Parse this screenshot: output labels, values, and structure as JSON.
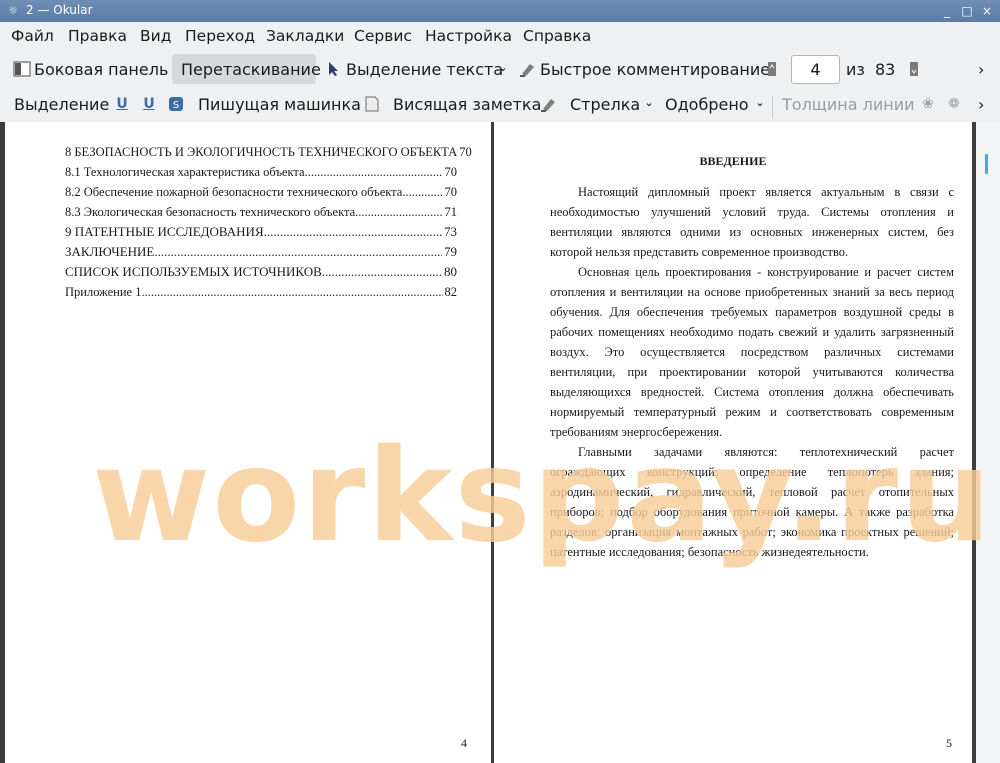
{
  "window": {
    "icon": "okular-icon",
    "title": "2  — Okular",
    "min": "_",
    "max": "□",
    "close": "×"
  },
  "menu": [
    "Файл",
    "Правка",
    "Вид",
    "Переход",
    "Закладки",
    "Сервис",
    "Настройка",
    "Справка"
  ],
  "toolbar1": {
    "sidebar": "Боковая панель",
    "drag": "Перетаскивание",
    "text_select": "Выделение текста",
    "quick_comment": "Быстрое комментирование",
    "page_current": "4",
    "page_of": "из",
    "page_total": "83",
    "more": "›"
  },
  "toolbar2": {
    "selection": "Выделение",
    "typewriter": "Пишущая машинка",
    "hanging_note": "Висящая заметка",
    "arrow": "Стрелка",
    "approved": "Одобрено",
    "line_width": "Толщина линии",
    "more": "›"
  },
  "left_page": {
    "toc": [
      {
        "label": "8 БЕЗОПАСНОСТЬ И ЭКОЛОГИЧНОСТЬ ТЕХНИЧЕСКОГО ОБЪЕКТА",
        "page": "70",
        "big": true
      },
      {
        "label": "8.1 Технологическая характеристика объекта",
        "page": "70",
        "big": false
      },
      {
        "label": "8.2 Обеспечение пожарной безопасности технического объекта",
        "page": "70",
        "big": false
      },
      {
        "label": "8.3 Экологическая безопасность технического объекта",
        "page": "71",
        "big": false
      },
      {
        "label": "9 ПАТЕНТНЫЕ ИССЛЕДОВАНИЯ",
        "page": "73",
        "big": true
      },
      {
        "label": "ЗАКЛЮЧЕНИЕ",
        "page": "79",
        "big": true
      },
      {
        "label": "СПИСОК ИСПОЛЬЗУЕМЫХ ИСТОЧНИКОВ",
        "page": "80",
        "big": true
      },
      {
        "label": "Приложение 1",
        "page": "82",
        "big": false
      }
    ],
    "page_number": "4"
  },
  "right_page": {
    "title": "ВВЕДЕНИЕ",
    "paragraphs": [
      "Настоящий дипломный проект является актуальным в связи с необходимостью улучшений условий труда. Системы отопления и вентиляции являются одними из основных инженерных систем, без которой нельзя представить современное производство.",
      "Основная цель проектирования - конструирование и расчет систем отопления и вентиляции на основе приобретенных знаний за весь период обучения. Для обеспечения требуемых параметров воздушной среды в рабочих помещениях необходимо подать свежий и удалить загрязненный воздух. Это осуществляется посредством различных системами вентиляции, при проектировании которой учитываются количества выделяющихся вредностей. Система отопления должна обеспечивать нормируемый температурный режим и соответствовать современным требованиям энергосбережения.",
      "Главными задачами являются: теплотехнический расчет ограждающих конструкций; определение теплопотерь здания; аэродинамический, гидравлический, тепловой расчет отопительных приборов; подбор оборудования приточной камеры. А также разработка разделов: организация монтажных работ; экономика проектных решений; патентные исследования; безопасность жизнедеятельности."
    ],
    "page_number": "5"
  },
  "watermark": "workspay.ru"
}
